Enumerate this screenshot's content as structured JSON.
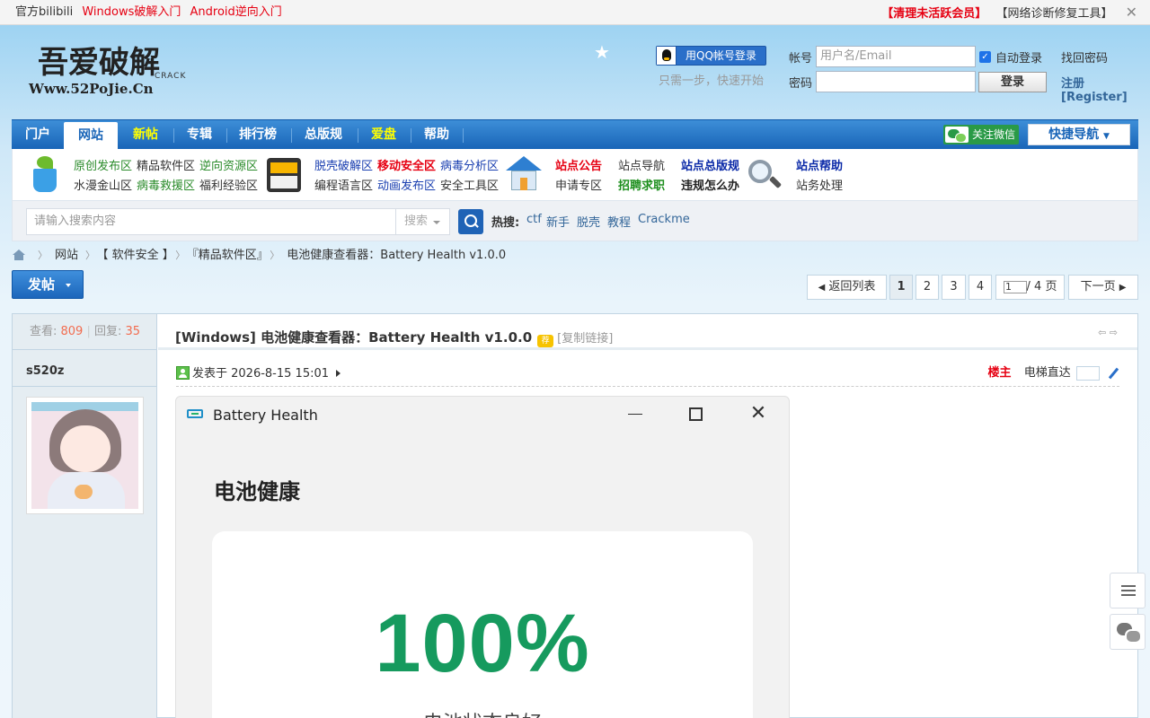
{
  "topbar": {
    "links": [
      "官方bilibili",
      "Windows破解入门",
      "Android逆向入门"
    ],
    "right_links": [
      "【清理未活跃会员】",
      "【网络诊断修复工具】"
    ]
  },
  "header": {
    "logo_main": "吾爱破解",
    "logo_url": "Www.52PoJie.Cn",
    "logo_crack": "CRACK",
    "qq_login": "用QQ帐号登录",
    "qq_hint": "只需一步，快速开始",
    "account_label": "帐号",
    "account_placeholder": "用户名/Email",
    "auto_login": "自动登录",
    "password_label": "密码",
    "login_button": "登录",
    "find_password": "找回密码",
    "register": "注册[Register]"
  },
  "nav": {
    "items": [
      "门户",
      "网站",
      "新帖",
      "专辑",
      "排行榜",
      "总版规",
      "爱盘",
      "帮助"
    ],
    "active": "网站",
    "wechat": "关注微信",
    "quick_nav": "快捷导航"
  },
  "subnav": {
    "group1_row1": [
      "原创发布区",
      "精品软件区",
      "逆向资源区"
    ],
    "group1_row2": [
      "水漫金山区",
      "病毒救援区",
      "福利经验区"
    ],
    "group2_row1": [
      "脱壳破解区",
      "移动安全区",
      "病毒分析区"
    ],
    "group2_row2": [
      "编程语言区",
      "动画发布区",
      "安全工具区"
    ],
    "group3_row1": [
      "站点公告",
      "站点导航",
      "站点总版规"
    ],
    "group3_row2": [
      "申请专区",
      "招聘求职",
      "违规怎么办"
    ],
    "group4_row1": [
      "站点帮助"
    ],
    "group4_row2": [
      "站务处理"
    ]
  },
  "search": {
    "placeholder": "请输入搜索内容",
    "type": "搜索",
    "hot_label": "热搜:",
    "hot_terms": [
      "ctf",
      "新手",
      "脱壳",
      "教程",
      "Crackme"
    ]
  },
  "breadcrumb": [
    "网站",
    "【 软件安全 】",
    "『精品软件区』",
    "电池健康查看器：Battery Health v1.0.0"
  ],
  "post_button": "发帖",
  "pager": {
    "back": "返回列表",
    "pages": [
      "1",
      "2",
      "3",
      "4"
    ],
    "current_input": "1",
    "total": "/ 4 页",
    "next": "下一页"
  },
  "thread": {
    "views_label": "查看:",
    "views": "809",
    "replies_label": "回复:",
    "replies": "35",
    "title": "[Windows] 电池健康查看器：Battery Health v1.0.0",
    "recommend": "荐",
    "copy_link": "[复制链接]",
    "author": "s520z",
    "posted": "发表于 2026-8-15 15:01",
    "floor": "楼主",
    "elevator": "电梯直达"
  },
  "app_window": {
    "title": "Battery Health",
    "heading": "电池健康",
    "percentage": "100%",
    "status": "电池状态良好"
  },
  "colors": {
    "nav_blue": "#1965b8",
    "accent_red": "#e60012",
    "battery_green": "#169a5e"
  }
}
